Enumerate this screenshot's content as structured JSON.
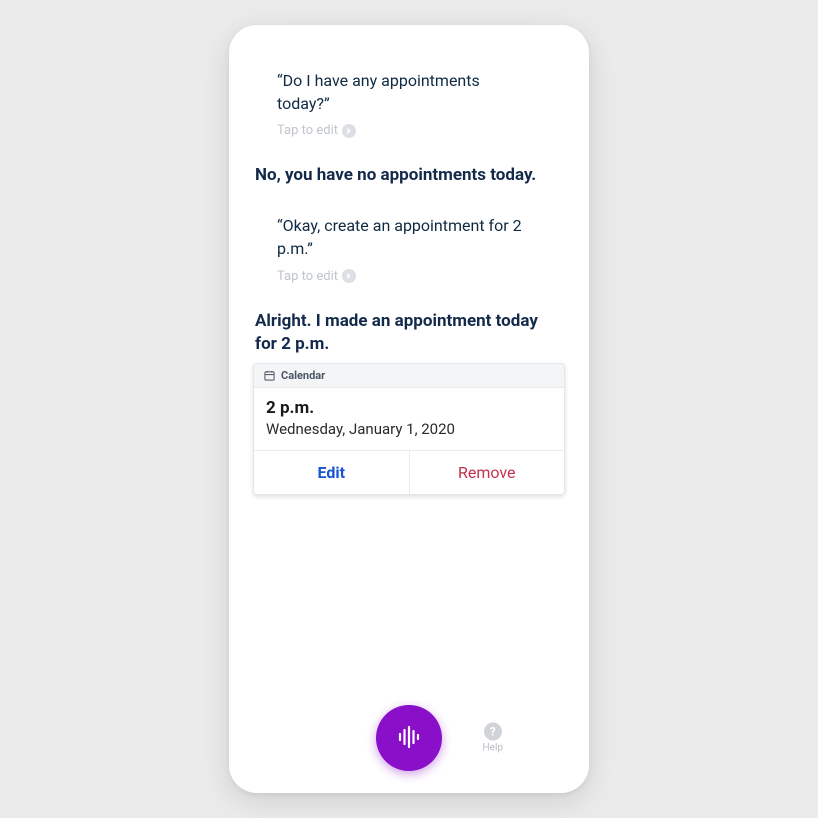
{
  "conversation": {
    "user1": "“Do I have any appointments today?”",
    "tap_to_edit": "Tap to edit",
    "assistant1": "No, you have no appointments today.",
    "user2": "“Okay, create an appointment for 2 p.m.”",
    "assistant2": "Alright. I made an appointment today for 2 p.m."
  },
  "card": {
    "header": "Calendar",
    "time": "2 p.m.",
    "date": "Wednesday, January 1, 2020",
    "edit": "Edit",
    "remove": "Remove"
  },
  "bottom": {
    "help": "Help"
  }
}
